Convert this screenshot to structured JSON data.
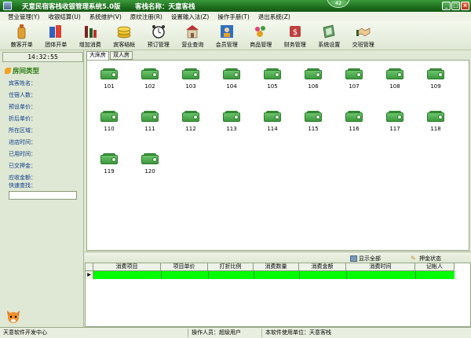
{
  "window": {
    "title": "天意民宿客栈收银管理系统5.0版",
    "shop_name": "客栈名称：天意客栈",
    "badge": "42",
    "buttons": [
      "_",
      "□",
      "×"
    ]
  },
  "menu": [
    "营业管理(Y)",
    "收银结算(U)",
    "系统维护(V)",
    "原纹注册(R)",
    "设置输入法(Z)",
    "操作手册(T)",
    "退出系统(Z)"
  ],
  "toolbar": [
    {
      "label": "散客开单",
      "icon": "bottle-icon"
    },
    {
      "label": "团体开单",
      "icon": "group-icon"
    },
    {
      "label": "增加消费",
      "icon": "wine-icon"
    },
    {
      "label": "宾客结帐",
      "icon": "coins-icon"
    },
    {
      "label": "预订管理",
      "icon": "alarm-clock-icon"
    },
    {
      "label": "营业查询",
      "icon": "building-icon"
    },
    {
      "label": "会员管理",
      "icon": "member-icon"
    },
    {
      "label": "商品管理",
      "icon": "goods-icon"
    },
    {
      "label": "财务管理",
      "icon": "finance-icon"
    },
    {
      "label": "系统设置",
      "icon": "settings-icon"
    },
    {
      "label": "交班管理",
      "icon": "handshake-icon"
    }
  ],
  "left_panel": {
    "clock": "14:32:55",
    "title": "房间类型",
    "fields": [
      "宾客姓名：",
      "住宿人数：",
      "预设单价：",
      "折后单价：",
      "所在区域：",
      "进店时间：",
      "已用时间：",
      "已交押金：",
      "应收金额：",
      "快速查找："
    ],
    "quick_search_value": ""
  },
  "tabs": [
    "大床房",
    "双人房"
  ],
  "rooms": [
    "101",
    "102",
    "103",
    "104",
    "105",
    "106",
    "107",
    "108",
    "109",
    "110",
    "111",
    "112",
    "113",
    "114",
    "115",
    "116",
    "117",
    "118",
    "119",
    "120"
  ],
  "sub_toolbar": {
    "show_all": "显示全部",
    "deposit_status": "押金状态"
  },
  "grid": {
    "columns": [
      "消费项目",
      "项目单价",
      "打折比例",
      "消费数量",
      "消费金额",
      "消费时间",
      "记帐人"
    ],
    "row_marker": "▶",
    "row_color": "#00ff00"
  },
  "status": {
    "developer": "天意软件开发中心",
    "operator": "操作人员：超级用户",
    "licensee": "本软件使用单位：天意客栈"
  },
  "colors": {
    "title_bar": "#1e6e1e",
    "room_icon": "#3d9a3d",
    "background": "#dfe8d4"
  }
}
